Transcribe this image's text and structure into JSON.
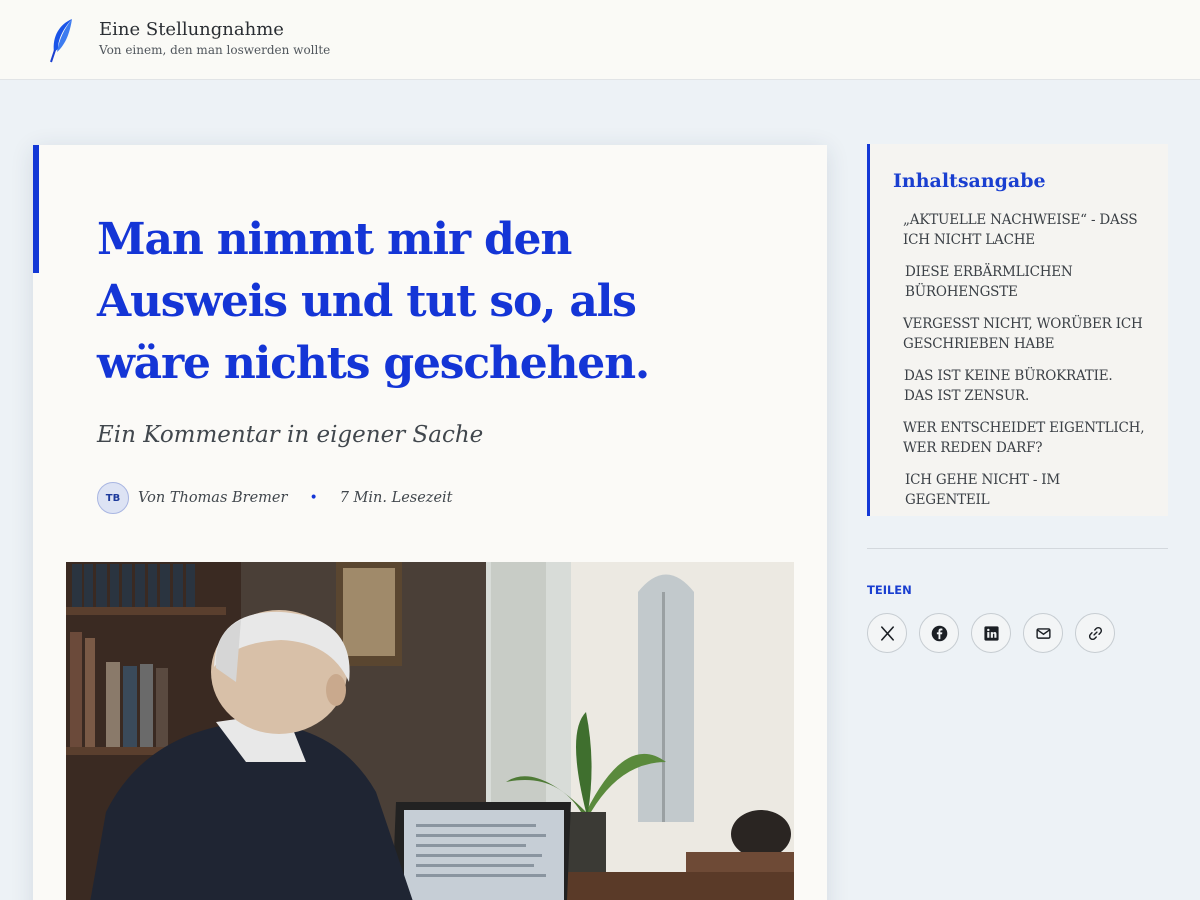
{
  "site": {
    "title": "Eine Stellungnahme",
    "tagline": "Von einem, den man loswerden wollte",
    "logo_icon": "feather-icon",
    "accent_color": "#1435d6"
  },
  "article": {
    "title": "Man nimmt mir den Ausweis und tut so, als wäre nichts geschehen.",
    "subtitle": "Ein Kommentar in eigener Sache",
    "author_initials": "TB",
    "author_line": "Von Thomas Bremer",
    "separator": "•",
    "reading_time": "7 Min. Lesezeit",
    "hero_image_icon": "photo-man-at-laptop"
  },
  "toc": {
    "heading": "Inhaltsangabe",
    "items": [
      "„Aktuelle Nachweise“ - dass ich nicht lache",
      "Diese erbärmlichen Bürohengste",
      "Vergesst nicht, worüber ich geschrieben habe",
      "Das ist keine Bürokratie. Das ist Zensur.",
      "Wer entscheidet eigentlich, wer reden darf?",
      "Ich gehe nicht - im Gegenteil"
    ]
  },
  "share": {
    "label": "TEILEN",
    "buttons": [
      "x-icon",
      "facebook-icon",
      "linkedin-icon",
      "mail-icon",
      "link-icon"
    ]
  }
}
